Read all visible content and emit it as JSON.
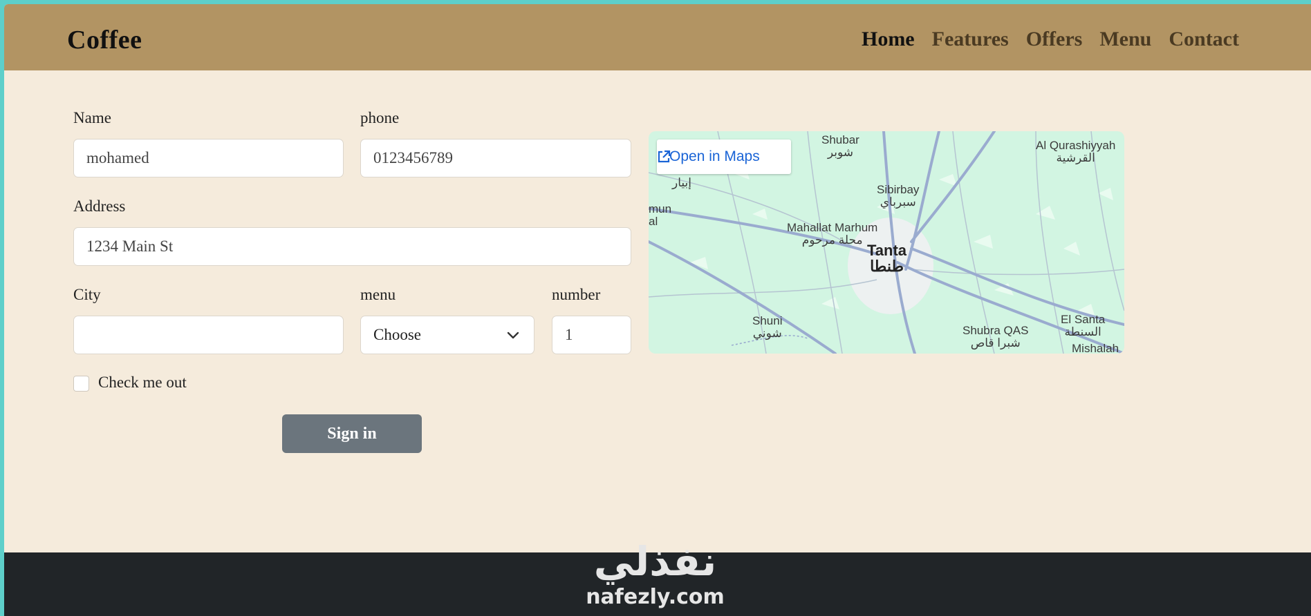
{
  "navbar": {
    "brand": "Coffee",
    "links": [
      {
        "label": "Home",
        "active": true
      },
      {
        "label": "Features",
        "active": false
      },
      {
        "label": "Offers",
        "active": false
      },
      {
        "label": "Menu",
        "active": false
      },
      {
        "label": "Contact",
        "active": false
      }
    ],
    "bg_color": "#b29463"
  },
  "form": {
    "name": {
      "label": "Name",
      "value": "mohamed"
    },
    "phone": {
      "label": "phone",
      "value": "0123456789"
    },
    "address": {
      "label": "Address",
      "value": "1234 Main St"
    },
    "city": {
      "label": "City",
      "value": ""
    },
    "menu": {
      "label": "menu",
      "selected": "Choose"
    },
    "number": {
      "label": "number",
      "value": "1"
    },
    "checkbox_label": "Check me out",
    "submit_label": "Sign in"
  },
  "map": {
    "open_label": "Open in Maps",
    "places": [
      {
        "name": "Shubar",
        "name_ar": "شوبر"
      },
      {
        "name": "Al Qurashiyyah",
        "name_ar": "القرشية"
      },
      {
        "name": "",
        "name_ar": "إبيار"
      },
      {
        "name": "Sibirbay",
        "name_ar": "سبرباي"
      },
      {
        "name": "mun",
        "name_ar": "al"
      },
      {
        "name": "Mahallat Marhum",
        "name_ar": "محلة مرحوم"
      },
      {
        "name": "Tanta",
        "name_ar": "طنطا"
      },
      {
        "name": "Shuni",
        "name_ar": "شوني"
      },
      {
        "name": "Shubra QAS",
        "name_ar": "شبرا قاص"
      },
      {
        "name": "El Santa",
        "name_ar": "السنطة"
      },
      {
        "name": "Mishalah",
        "name_ar": ""
      }
    ]
  },
  "footer": {
    "watermark_ar": "نفذلي",
    "watermark_en": "nafezly.com"
  },
  "colors": {
    "page_bg": "#f5ebdc",
    "footer_bg": "#212528",
    "button_bg": "#6b757d",
    "map_link": "#1a64d6"
  }
}
